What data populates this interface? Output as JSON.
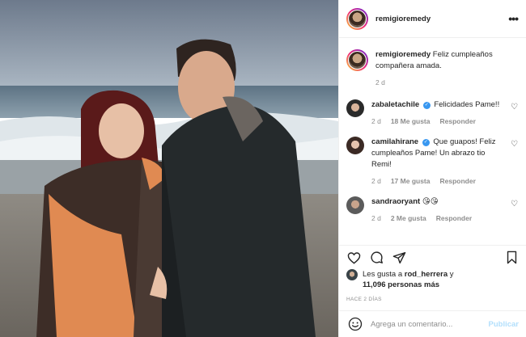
{
  "post": {
    "author": "remigioremedy",
    "more_label": "•••",
    "caption_text": "Feliz cumpleaños compañera amada.",
    "caption_age": "2 d"
  },
  "comments": [
    {
      "user": "zabaletachile",
      "verified": true,
      "text": "Felicidades Pame!!",
      "age": "2 d",
      "likes": "18 Me gusta",
      "reply": "Responder"
    },
    {
      "user": "camilahirane",
      "verified": true,
      "text": "Que guapos! Feliz cumpleaños Pame! Un abrazo tio Remi!",
      "age": "2 d",
      "likes": "17 Me gusta",
      "reply": "Responder"
    },
    {
      "user": "sandraoryant",
      "verified": false,
      "text": "😘😘",
      "age": "2 d",
      "likes": "2 Me gusta",
      "reply": "Responder"
    }
  ],
  "likes": {
    "prefix": "Les gusta a ",
    "user": "rod_herrera",
    "joiner": " y",
    "others": "11,096 personas más"
  },
  "timestamp": "HACE 2 DÍAS",
  "add_comment": {
    "placeholder": "Agrega un comentario...",
    "publish": "Publicar"
  },
  "icons": {
    "heart": "heart-icon",
    "comment": "comment-icon",
    "share": "share-icon",
    "save": "bookmark-icon",
    "emoji": "emoji-icon",
    "more": "more-icon"
  },
  "colors": {
    "link_blue": "#3897f0",
    "publish_disabled": "#b2dffc",
    "muted": "#8e8e8e",
    "border": "#efefef"
  }
}
